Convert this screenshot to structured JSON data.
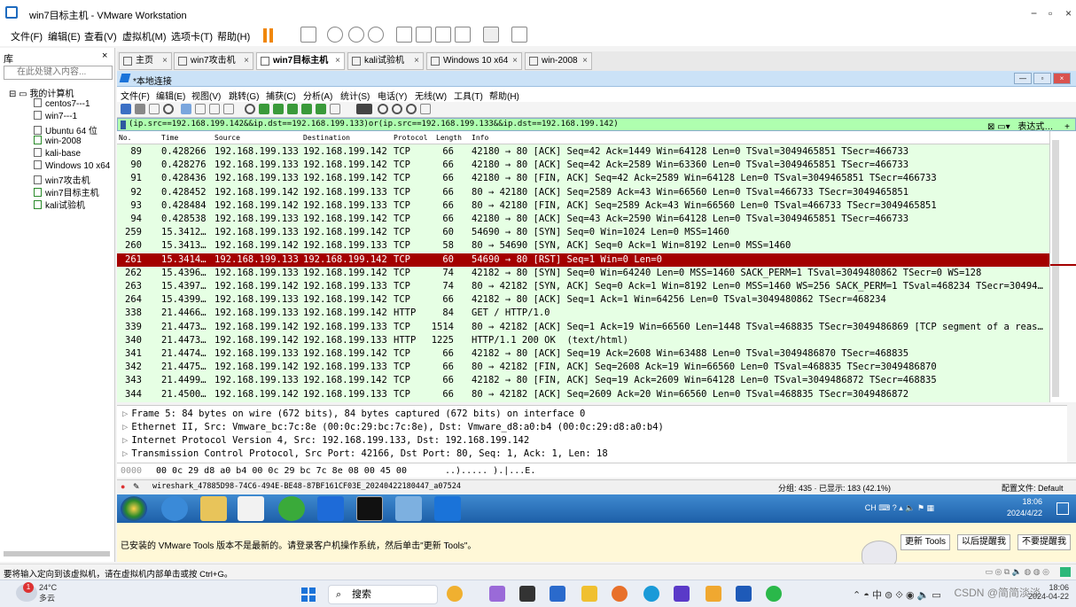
{
  "window": {
    "title": "win7目标主机 - VMware Workstation",
    "min": "−",
    "restore": "▫",
    "close": "×"
  },
  "vm_menu": [
    "文件(F)",
    "编辑(E)",
    "查看(V)",
    "虚拟机(M)",
    "选项卡(T)",
    "帮助(H)"
  ],
  "library": {
    "title": "库",
    "close": "×",
    "search_placeholder": "在此处键入内容...",
    "root": "我的计算机",
    "items": [
      "centos7---1",
      "win7---1",
      "Ubuntu 64 位",
      "win-2008",
      "kali-base",
      "Windows 10 x64",
      "win7攻击机",
      "win7目标主机",
      "kali试验机"
    ]
  },
  "tabs": [
    {
      "label": "主页",
      "active": false
    },
    {
      "label": "win7攻击机",
      "active": false
    },
    {
      "label": "win7目标主机",
      "active": true
    },
    {
      "label": "kali试验机",
      "active": false
    },
    {
      "label": "Windows 10 x64",
      "active": false
    },
    {
      "label": "win-2008",
      "active": false
    }
  ],
  "guest_window_title": "*本地连接",
  "ws_menu": [
    "文件(F)",
    "编辑(E)",
    "视图(V)",
    "跳转(G)",
    "捕获(C)",
    "分析(A)",
    "统计(S)",
    "电话(Y)",
    "无线(W)",
    "工具(T)",
    "帮助(H)"
  ],
  "filter": {
    "expression": "(ip.src==192.168.199.142&&ip.dst==192.168.199.133)or(ip.src==192.168.199.133&&ip.dst==192.168.199.142)",
    "label": "表达式…",
    "plus": "+"
  },
  "columns": [
    "No.",
    "Time",
    "Source",
    "Destination",
    "Protocol",
    "Length",
    "Info"
  ],
  "packets": [
    {
      "no": "89",
      "time": "0.428266",
      "src": "192.168.199.133",
      "dst": "192.168.199.142",
      "proto": "TCP",
      "len": "66",
      "info": "42180 → 80 [ACK] Seq=42 Ack=1449 Win=64128 Len=0 TSval=3049465851 TSecr=466733"
    },
    {
      "no": "90",
      "time": "0.428276",
      "src": "192.168.199.133",
      "dst": "192.168.199.142",
      "proto": "TCP",
      "len": "66",
      "info": "42180 → 80 [ACK] Seq=42 Ack=2589 Win=63360 Len=0 TSval=3049465851 TSecr=466733"
    },
    {
      "no": "91",
      "time": "0.428436",
      "src": "192.168.199.133",
      "dst": "192.168.199.142",
      "proto": "TCP",
      "len": "66",
      "info": "42180 → 80 [FIN, ACK] Seq=42 Ack=2589 Win=64128 Len=0 TSval=3049465851 TSecr=466733"
    },
    {
      "no": "92",
      "time": "0.428452",
      "src": "192.168.199.142",
      "dst": "192.168.199.133",
      "proto": "TCP",
      "len": "66",
      "info": "80 → 42180 [ACK] Seq=2589 Ack=43 Win=66560 Len=0 TSval=466733 TSecr=3049465851"
    },
    {
      "no": "93",
      "time": "0.428484",
      "src": "192.168.199.142",
      "dst": "192.168.199.133",
      "proto": "TCP",
      "len": "66",
      "info": "80 → 42180 [FIN, ACK] Seq=2589 Ack=43 Win=66560 Len=0 TSval=466733 TSecr=3049465851"
    },
    {
      "no": "94",
      "time": "0.428538",
      "src": "192.168.199.133",
      "dst": "192.168.199.142",
      "proto": "TCP",
      "len": "66",
      "info": "42180 → 80 [ACK] Seq=43 Ack=2590 Win=64128 Len=0 TSval=3049465851 TSecr=466733"
    },
    {
      "no": "259",
      "time": "15.3412…",
      "src": "192.168.199.133",
      "dst": "192.168.199.142",
      "proto": "TCP",
      "len": "60",
      "info": "54690 → 80 [SYN] Seq=0 Win=1024 Len=0 MSS=1460"
    },
    {
      "no": "260",
      "time": "15.3413…",
      "src": "192.168.199.142",
      "dst": "192.168.199.133",
      "proto": "TCP",
      "len": "58",
      "info": "80 → 54690 [SYN, ACK] Seq=0 Ack=1 Win=8192 Len=0 MSS=1460"
    },
    {
      "no": "261",
      "time": "15.3414…",
      "src": "192.168.199.133",
      "dst": "192.168.199.142",
      "proto": "TCP",
      "len": "60",
      "info": "54690 → 80 [RST] Seq=1 Win=0 Len=0",
      "selected": true
    },
    {
      "no": "262",
      "time": "15.4396…",
      "src": "192.168.199.133",
      "dst": "192.168.199.142",
      "proto": "TCP",
      "len": "74",
      "info": "42182 → 80 [SYN] Seq=0 Win=64240 Len=0 MSS=1460 SACK_PERM=1 TSval=3049480862 TSecr=0 WS=128"
    },
    {
      "no": "263",
      "time": "15.4397…",
      "src": "192.168.199.142",
      "dst": "192.168.199.133",
      "proto": "TCP",
      "len": "74",
      "info": "80 → 42182 [SYN, ACK] Seq=0 Ack=1 Win=8192 Len=0 MSS=1460 WS=256 SACK_PERM=1 TSval=468234 TSecr=30494…"
    },
    {
      "no": "264",
      "time": "15.4399…",
      "src": "192.168.199.133",
      "dst": "192.168.199.142",
      "proto": "TCP",
      "len": "66",
      "info": "42182 → 80 [ACK] Seq=1 Ack=1 Win=64256 Len=0 TSval=3049480862 TSecr=468234"
    },
    {
      "no": "338",
      "time": "21.4466…",
      "src": "192.168.199.133",
      "dst": "192.168.199.142",
      "proto": "HTTP",
      "len": "84",
      "info": "GET / HTTP/1.0"
    },
    {
      "no": "339",
      "time": "21.4473…",
      "src": "192.168.199.142",
      "dst": "192.168.199.133",
      "proto": "TCP",
      "len": "1514",
      "info": "80 → 42182 [ACK] Seq=1 Ack=19 Win=66560 Len=1448 TSval=468835 TSecr=3049486869 [TCP segment of a reas…"
    },
    {
      "no": "340",
      "time": "21.4473…",
      "src": "192.168.199.142",
      "dst": "192.168.199.133",
      "proto": "HTTP",
      "len": "1225",
      "info": "HTTP/1.1 200 OK  (text/html)"
    },
    {
      "no": "341",
      "time": "21.4474…",
      "src": "192.168.199.133",
      "dst": "192.168.199.142",
      "proto": "TCP",
      "len": "66",
      "info": "42182 → 80 [ACK] Seq=19 Ack=2608 Win=63488 Len=0 TSval=3049486870 TSecr=468835"
    },
    {
      "no": "342",
      "time": "21.4475…",
      "src": "192.168.199.142",
      "dst": "192.168.199.133",
      "proto": "TCP",
      "len": "66",
      "info": "80 → 42182 [FIN, ACK] Seq=2608 Ack=19 Win=66560 Len=0 TSval=468835 TSecr=3049486870"
    },
    {
      "no": "343",
      "time": "21.4499…",
      "src": "192.168.199.133",
      "dst": "192.168.199.142",
      "proto": "TCP",
      "len": "66",
      "info": "42182 → 80 [FIN, ACK] Seq=19 Ack=2609 Win=64128 Len=0 TSval=3049486872 TSecr=468835"
    },
    {
      "no": "344",
      "time": "21.4500…",
      "src": "192.168.199.142",
      "dst": "192.168.199.133",
      "proto": "TCP",
      "len": "66",
      "info": "80 → 42182 [ACK] Seq=2609 Ack=20 Win=66560 Len=0 TSval=468835 TSecr=3049486872"
    }
  ],
  "details": [
    "Frame 5: 84 bytes on wire (672 bits), 84 bytes captured (672 bits) on interface 0",
    "Ethernet II, Src: Vmware_bc:7c:8e (00:0c:29:bc:7c:8e), Dst: Vmware_d8:a0:b4 (00:0c:29:d8:a0:b4)",
    "Internet Protocol Version 4, Src: 192.168.199.133, Dst: 192.168.199.142",
    "Transmission Control Protocol, Src Port: 42166, Dst Port: 80, Seq: 1, Ack: 1, Len: 18"
  ],
  "bytes": {
    "offset": "0000",
    "hex": "00 0c 29 d8 a0 b4 00 0c  29 bc 7c 8e 08 00 45 00",
    "ascii": "..)..... ).|...E."
  },
  "ws_status": {
    "file": "wireshark_47885D98-74C6-494E-BE48-87BF161CF03E_20240422180447_a07524",
    "packets": "分组: 435 · 已显示: 183 (42.1%)",
    "profile": "配置文件: Default"
  },
  "guest_clock": {
    "time": "18:06",
    "date": "2024/4/22",
    "lang": "CH"
  },
  "notice": {
    "text": "已安装的 VMware Tools 版本不是最新的。请登录客户机操作系统，然后单击\"更新 Tools\"。",
    "update": "更新 Tools",
    "later": "以后提醒我",
    "never": "不要提醒我"
  },
  "vm_status": "要将输入定向到该虚拟机，请在虚拟机内部单击或按 Ctrl+G。",
  "host": {
    "weather_temp": "24°C",
    "weather_desc": "多云",
    "badge": "1",
    "search": "搜索",
    "time": "18:06",
    "date": "2024-04-22",
    "watermark": "CSDN @简简淡淡"
  },
  "colors": {
    "selected_row": "#a40000",
    "packet_bg": "#e6ffe4",
    "filter_bg": "#afffaf",
    "guest_taskbar": "#2f78c4"
  }
}
